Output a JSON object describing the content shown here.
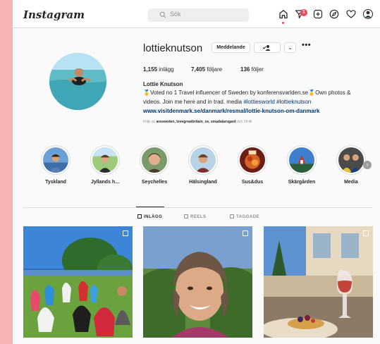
{
  "app": {
    "logo": "Instagram"
  },
  "search": {
    "placeholder": "Sök"
  },
  "nav": {
    "activity_count": "1"
  },
  "profile": {
    "username": "lottieknutson",
    "message_button": "Meddelande",
    "posts_count": "1,155",
    "posts_label": "inlägg",
    "followers_count": "7,405",
    "followers_label": "följare",
    "following_count": "136",
    "following_label": "följer",
    "name": "Lottie Knutson",
    "bio_line1": "🥇Voted no 1 Travel influencer of Sweden by konferensvarlden.se🥇Own photos &",
    "bio_line2_text": "videos. Join me here and in trad. media ",
    "bio_hashtags": "#lottiesworld #lottieknutson",
    "website": "www.visitdenmark.se/danmark/resmal/lottie-knutson-om-danmark",
    "followed_by_prefix": "Följs av ",
    "followed_by_names": "aresweden, lovegreatbritain_se, smadalarogard",
    "followed_by_suffix": " och 14 till"
  },
  "highlights": [
    {
      "label": "Tyskland"
    },
    {
      "label": "Jyllands h..."
    },
    {
      "label": "Seychelles"
    },
    {
      "label": "Hälsingland"
    },
    {
      "label": "Sus&dus"
    },
    {
      "label": "Skärgården"
    },
    {
      "label": "Media"
    }
  ],
  "tabs": [
    {
      "label": "INLÄGG",
      "active": true
    },
    {
      "label": "REELS",
      "active": false
    },
    {
      "label": "TAGGADE",
      "active": false
    }
  ],
  "colors": {
    "accent": "#ed4956",
    "link": "#00376b",
    "background": "#fafafa",
    "backdrop": "#f7b3b3"
  }
}
